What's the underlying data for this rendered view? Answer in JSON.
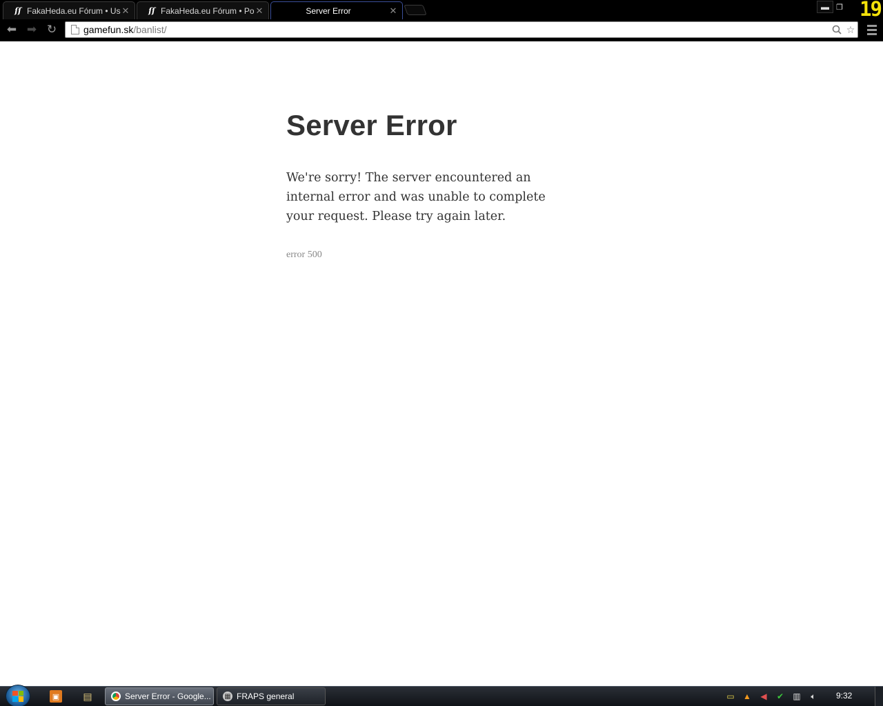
{
  "browser": {
    "tabs": [
      {
        "title": "FakaHeda.eu Fórum • Use",
        "favicon": "fakaheda-icon",
        "active": false
      },
      {
        "title": "FakaHeda.eu Fórum • Pos",
        "favicon": "fakaheda-icon",
        "active": false
      },
      {
        "title": "Server Error",
        "favicon": "",
        "active": true
      }
    ],
    "fps_counter": "19",
    "address": {
      "host": "gamefun.sk",
      "path": "/banlist/"
    }
  },
  "page": {
    "title": "Server Error",
    "message": "We're sorry! The server encountered an internal error and was unable to complete your request. Please try again later.",
    "code": "error 500"
  },
  "taskbar": {
    "tasks": [
      {
        "label": "Server Error - Google...",
        "icon": "chrome-icon",
        "active": true
      },
      {
        "label": "FRAPS general",
        "icon": "fraps-icon",
        "active": false
      }
    ],
    "clock": "9:32"
  }
}
